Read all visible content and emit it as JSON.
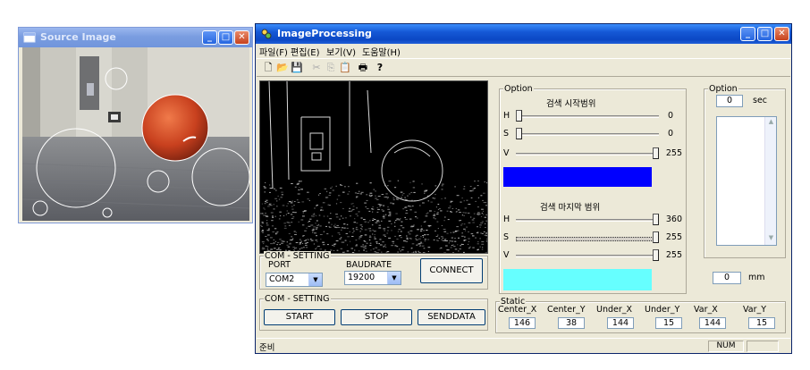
{
  "source_window": {
    "title": "Source Image",
    "min_glyph": "_",
    "max_glyph": "□",
    "close_glyph": "✕"
  },
  "main_window": {
    "title": "ImageProcessing",
    "min_glyph": "_",
    "max_glyph": "□",
    "close_glyph": "✕",
    "menu": [
      "파일(F)",
      "편집(E)",
      "보기(V)",
      "도움말(H)"
    ],
    "toolbar": {
      "new": "🗋",
      "open": "📂",
      "save": "💾",
      "cut": "✂",
      "copy": "⎘",
      "paste": "📋",
      "print": "🖶",
      "help": "?"
    }
  },
  "com_setting": {
    "title": "COM - SETTING",
    "port_label": "PORT",
    "baud_label": "BAUDRATE",
    "port_value": "COM2",
    "baud_value": "19200",
    "connect_label": "CONNECT"
  },
  "com_setting2": {
    "title": "COM - SETTING",
    "start_label": "START",
    "stop_label": "STOP",
    "send_label": "SENDDATA"
  },
  "option": {
    "title": "Option",
    "start_range_title": "검색 시작범위",
    "end_range_title": "검색 마지막 범위",
    "start": [
      {
        "label": "H",
        "value": "0",
        "frac": 0.0
      },
      {
        "label": "S",
        "value": "0",
        "frac": 0.0
      },
      {
        "label": "V",
        "value": "255",
        "frac": 1.0
      }
    ],
    "end": [
      {
        "label": "H",
        "value": "360",
        "frac": 1.0
      },
      {
        "label": "S",
        "value": "255",
        "frac": 1.0
      },
      {
        "label": "V",
        "value": "255",
        "frac": 1.0
      }
    ],
    "start_color": "#0000ff",
    "end_color": "#66ffff"
  },
  "option2": {
    "title": "Option",
    "sec_value": "0",
    "sec_unit": "sec",
    "mm_value": "0",
    "mm_unit": "mm"
  },
  "static": {
    "title": "Static",
    "headers": [
      "Center_X",
      "Center_Y",
      "Under_X",
      "Under_Y",
      "Var_X",
      "Var_Y"
    ],
    "values": [
      "146",
      "38",
      "144",
      "15",
      "144",
      "15"
    ]
  },
  "status": {
    "left": "준비",
    "num": "NUM"
  }
}
